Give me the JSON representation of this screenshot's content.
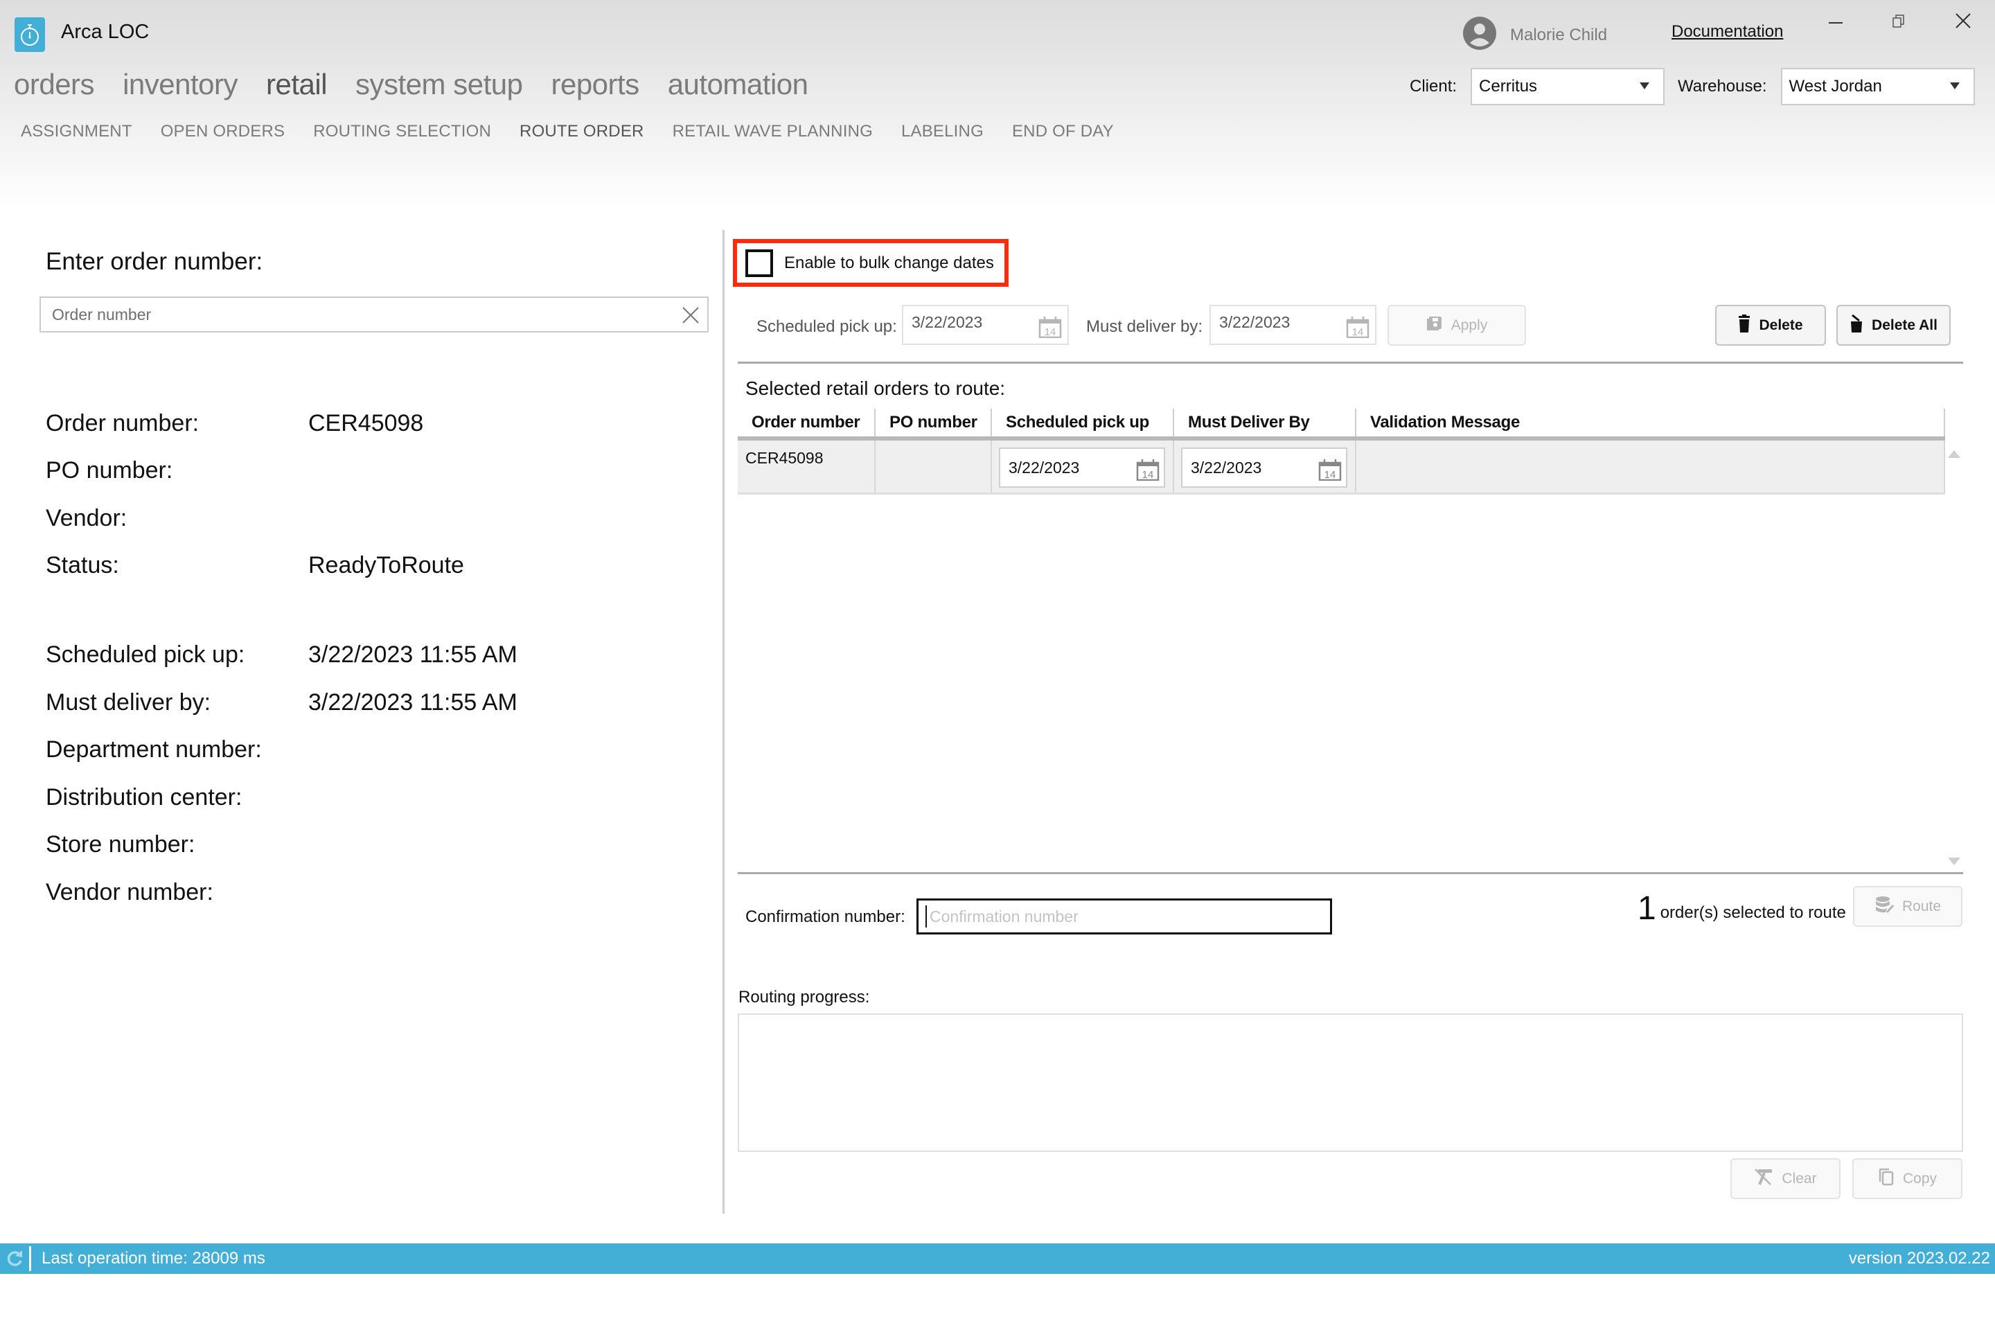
{
  "app": {
    "title": "Arca LOC",
    "user_name": "Malorie Child",
    "documentation_label": "Documentation"
  },
  "main_nav": [
    {
      "label": "orders",
      "active": false
    },
    {
      "label": "inventory",
      "active": false
    },
    {
      "label": "retail",
      "active": true
    },
    {
      "label": "system setup",
      "active": false
    },
    {
      "label": "reports",
      "active": false
    },
    {
      "label": "automation",
      "active": false
    }
  ],
  "sub_nav": [
    {
      "label": "ASSIGNMENT",
      "active": false
    },
    {
      "label": "OPEN ORDERS",
      "active": false
    },
    {
      "label": "ROUTING SELECTION",
      "active": false
    },
    {
      "label": "ROUTE ORDER",
      "active": true
    },
    {
      "label": "RETAIL WAVE PLANNING",
      "active": false
    },
    {
      "label": "LABELING",
      "active": false
    },
    {
      "label": "END OF DAY",
      "active": false
    }
  ],
  "selectors": {
    "client_label": "Client:",
    "client_value": "Cerritus",
    "warehouse_label": "Warehouse:",
    "warehouse_value": "West Jordan"
  },
  "left_panel": {
    "title": "Enter order number:",
    "order_input_placeholder": "Order number",
    "order_input_value": "",
    "details": [
      {
        "label": "Order number:",
        "value": "CER45098"
      },
      {
        "label": "PO number:",
        "value": ""
      },
      {
        "label": "Vendor:",
        "value": ""
      },
      {
        "label": "Status:",
        "value": "ReadyToRoute"
      },
      {
        "label": "Scheduled pick up:",
        "value": "3/22/2023 11:55 AM"
      },
      {
        "label": "Must deliver by:",
        "value": "3/22/2023 11:55 AM"
      },
      {
        "label": "Department number:",
        "value": ""
      },
      {
        "label": "Distribution center:",
        "value": ""
      },
      {
        "label": "Store number:",
        "value": ""
      },
      {
        "label": "Vendor number:",
        "value": ""
      }
    ]
  },
  "bulk": {
    "checkbox_label": "Enable to bulk change dates",
    "checked": false,
    "highlight_color": "#ff2a0a",
    "scheduled_pickup_label": "Scheduled pick up:",
    "scheduled_pickup_value": "3/22/2023",
    "must_deliver_label": "Must deliver by:",
    "must_deliver_value": "3/22/2023",
    "apply_label": "Apply",
    "delete_label": "Delete",
    "delete_all_label": "Delete All",
    "calendar_day": "14"
  },
  "orders_table": {
    "title": "Selected retail orders to route:",
    "columns": [
      "Order number",
      "PO number",
      "Scheduled pick up",
      "Must Deliver By",
      "Validation Message"
    ],
    "rows": [
      {
        "order_number": "CER45098",
        "po_number": "",
        "scheduled_pickup": "3/22/2023",
        "must_deliver_by": "3/22/2023",
        "validation_message": ""
      }
    ]
  },
  "confirmation": {
    "label": "Confirmation number:",
    "placeholder": "Confirmation number",
    "value": ""
  },
  "route": {
    "count": "1",
    "count_text": "order(s) selected to route",
    "route_label": "Route"
  },
  "routing_progress": {
    "label": "Routing progress:",
    "content": "",
    "clear_label": "Clear",
    "copy_label": "Copy"
  },
  "status_bar": {
    "last_operation": "Last operation time:  28009 ms",
    "version": "version 2023.02.22",
    "color": "#43afd6"
  }
}
